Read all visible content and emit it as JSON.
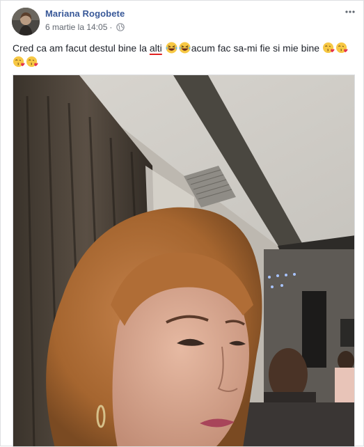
{
  "post": {
    "author": "Mariana Rogobete",
    "date": "6 martie la 14:05",
    "separator": "·",
    "text_part1": "Cred ca am facut destul bine la ",
    "text_misspelled": "alti",
    "text_part2": "acum fac sa-mi fie si mie bine",
    "emojis": [
      "laughing-emoji",
      "laughing-emoji",
      "kissing-heart-emoji",
      "kissing-heart-emoji",
      "kissing-heart-emoji",
      "kissing-heart-emoji"
    ]
  },
  "icons": {
    "privacy": "globe-icon",
    "options": "more-options-icon"
  },
  "colors": {
    "author_link": "#385898",
    "meta_text": "#616770",
    "body_text": "#1d2129",
    "spellcheck": "#e02020"
  }
}
